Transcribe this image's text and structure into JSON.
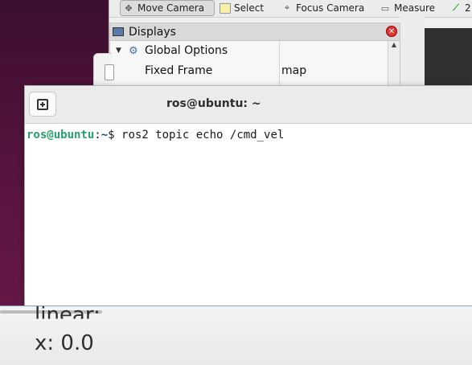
{
  "rviz": {
    "toolbar": [
      {
        "label": "Move Camera",
        "icon": "move-camera-icon",
        "active": true
      },
      {
        "label": "Select",
        "icon": "select-icon",
        "active": false
      },
      {
        "label": "Focus Camera",
        "icon": "focus-camera-icon",
        "active": false
      },
      {
        "label": "Measure",
        "icon": "measure-icon",
        "active": false
      },
      {
        "label": "2",
        "icon": "pose-estimate-icon",
        "active": false
      }
    ],
    "displays_title": "Displays",
    "tree": {
      "global_options": "Global Options",
      "fixed_frame_label": "Fixed Frame",
      "fixed_frame_value": "map"
    }
  },
  "terminal": {
    "title": "ros@ubuntu: ~",
    "prompt_user": "ros@ubuntu",
    "prompt_sep": ":",
    "prompt_path": "~",
    "prompt_symbol": "$ ",
    "command": "ros2 topic echo /cmd_vel"
  },
  "bottom": {
    "clipped_line": "linear:",
    "value_line": "x: 0.0"
  },
  "colors": {
    "desktop": "#5a1540",
    "prompt_user": "#26a269",
    "prompt_path": "#12488b"
  }
}
